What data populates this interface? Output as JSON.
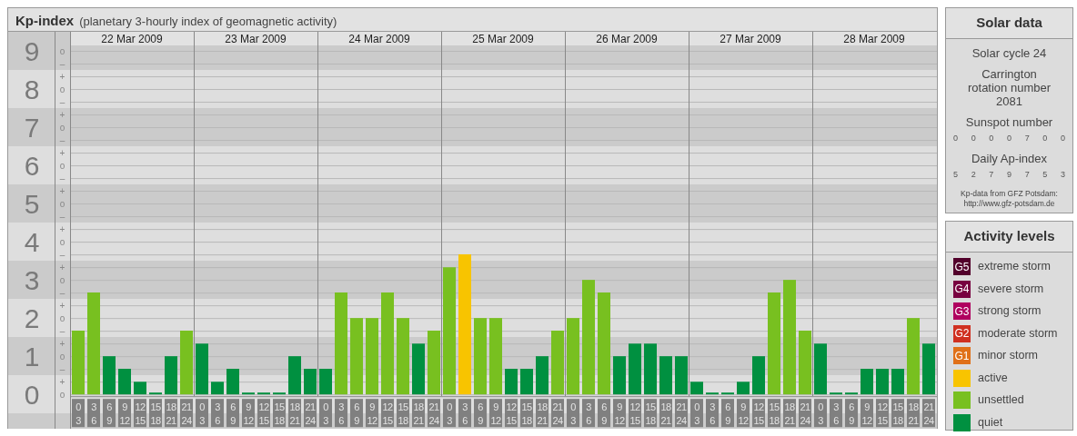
{
  "kp_panel": {
    "title": "Kp-index",
    "subtitle": "(planetary 3-hourly index of geomagnetic activity)",
    "date_labels": [
      "22 Mar 2009",
      "23 Mar 2009",
      "24 Mar 2009",
      "25 Mar 2009",
      "26 Mar 2009",
      "27 Mar 2009",
      "28 Mar 2009"
    ],
    "minor_tick_labels": [
      "o",
      "–",
      "+",
      "o",
      "–",
      "+",
      "o",
      "–",
      "+",
      "o",
      "–",
      "+",
      "o",
      "–",
      "+",
      "o",
      "–",
      "+",
      "o",
      "–",
      "+",
      "o",
      "–",
      "+",
      "o",
      "–",
      "+",
      "o"
    ],
    "chart_data": {
      "type": "bar",
      "grid": true,
      "ylim": [
        -0.9,
        9.5
      ],
      "categories": [
        "0 3",
        "3 6",
        "6 9",
        "9 12",
        "12 15",
        "15 18",
        "18 21",
        "21 24",
        "0 3",
        "3 6",
        "6 9",
        "9 12",
        "12 15",
        "15 18",
        "18 21",
        "21 24",
        "0 3",
        "3 6",
        "6 9",
        "9 12",
        "12 15",
        "15 18",
        "18 21",
        "21 24",
        "0 3",
        "3 6",
        "6 9",
        "9 12",
        "12 15",
        "15 18",
        "18 21",
        "21 24",
        "0 3",
        "3 6",
        "6 9",
        "9 12",
        "12 15",
        "15 18",
        "18 21",
        "21 24",
        "0 3",
        "3 6",
        "6 9",
        "9 12",
        "12 15",
        "15 18",
        "18 21",
        "21 24",
        "0 3",
        "3 6",
        "6 9",
        "9 12",
        "12 15",
        "15 18",
        "18 21",
        "21 24"
      ],
      "yticks": [
        {
          "value": 0,
          "label": "0"
        },
        {
          "value": 1,
          "label": "1"
        },
        {
          "value": 2,
          "label": "2"
        },
        {
          "value": 3,
          "label": "3"
        },
        {
          "value": 4,
          "label": "4"
        },
        {
          "value": 5,
          "label": "5"
        },
        {
          "value": 6,
          "label": "6"
        },
        {
          "value": 7,
          "label": "7"
        },
        {
          "value": 8,
          "label": "8"
        },
        {
          "value": 9,
          "label": "9"
        }
      ],
      "series": [
        {
          "name": "quiet",
          "color": "#009040",
          "values": [
            null,
            null,
            1,
            0.67,
            0.33,
            0,
            1,
            null,
            1.33,
            0.33,
            0.67,
            0,
            0,
            0,
            1,
            0.67,
            0.67,
            null,
            null,
            null,
            null,
            null,
            1.33,
            null,
            null,
            null,
            null,
            null,
            0.67,
            0.67,
            1,
            null,
            null,
            null,
            null,
            1,
            1.33,
            1.33,
            1,
            1,
            0.33,
            0,
            0,
            0.33,
            1,
            null,
            null,
            null,
            1.33,
            0,
            0,
            0.67,
            0.67,
            0.67,
            null,
            1.33
          ]
        },
        {
          "name": "unsettled",
          "color": "#78c020",
          "values": [
            1.67,
            2.67,
            null,
            null,
            null,
            null,
            null,
            1.67,
            null,
            null,
            null,
            null,
            null,
            null,
            null,
            null,
            null,
            2.67,
            2,
            2,
            2.67,
            2,
            null,
            1.67,
            3.33,
            null,
            2,
            2,
            null,
            null,
            null,
            1.67,
            2,
            3,
            2.67,
            null,
            null,
            null,
            null,
            null,
            null,
            null,
            null,
            null,
            null,
            2.67,
            3,
            1.67,
            null,
            null,
            null,
            null,
            null,
            null,
            2,
            null
          ]
        },
        {
          "name": "active",
          "color": "#f8c400",
          "values": [
            null,
            null,
            null,
            null,
            null,
            null,
            null,
            null,
            null,
            null,
            null,
            null,
            null,
            null,
            null,
            null,
            null,
            null,
            null,
            null,
            null,
            null,
            null,
            null,
            null,
            3.67,
            null,
            null,
            null,
            null,
            null,
            null,
            null,
            null,
            null,
            null,
            null,
            null,
            null,
            null,
            null,
            null,
            null,
            null,
            null,
            null,
            null,
            null,
            null,
            null,
            null,
            null,
            null,
            null,
            null,
            null
          ]
        }
      ]
    }
  },
  "solar_data": {
    "title": "Solar data",
    "cycle": "Solar cycle 24",
    "rotation": "Carrington rotation number 2081",
    "sunspot_label": "Sunspot number",
    "sunspot_values": [
      "0",
      "0",
      "0",
      "0",
      "7",
      "0",
      "0"
    ],
    "ap_label": "Daily Ap-index",
    "ap_values": [
      "5",
      "2",
      "7",
      "9",
      "7",
      "5",
      "3"
    ],
    "source": "Kp-data from GFZ Potsdam:",
    "source_url": "http://www.gfz-potsdam.de"
  },
  "activity_levels": {
    "title": "Activity levels",
    "items": [
      {
        "badge": "G5",
        "label": "extreme storm",
        "color": "#52002b"
      },
      {
        "badge": "G4",
        "label": "severe storm",
        "color": "#780040"
      },
      {
        "badge": "G3",
        "label": "strong storm",
        "color": "#b0005f"
      },
      {
        "badge": "G2",
        "label": "moderate storm",
        "color": "#d03020"
      },
      {
        "badge": "G1",
        "label": "minor storm",
        "color": "#e07018"
      }
    ]
  }
}
